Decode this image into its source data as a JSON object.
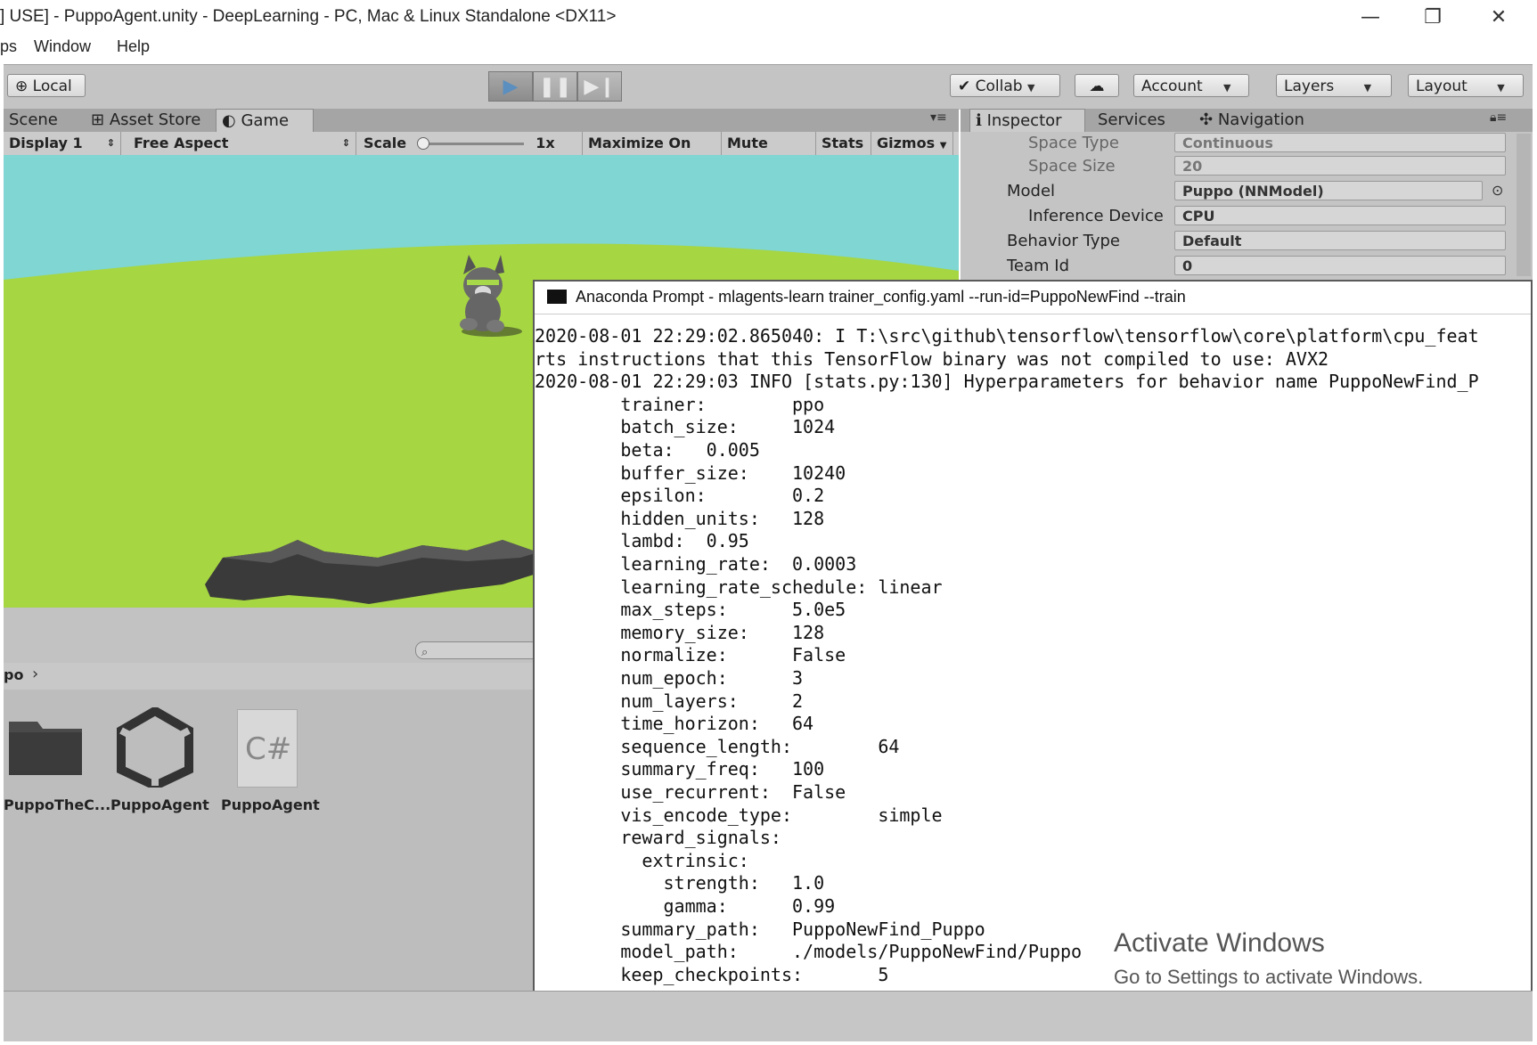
{
  "window": {
    "title": "] USE] - PuppoAgent.unity - DeepLearning - PC, Mac & Linux Standalone <DX11>",
    "controls": {
      "minimize": "—",
      "restore": "❐",
      "close": "✕"
    }
  },
  "menu": {
    "items": [
      "ps",
      "Window",
      "Help"
    ]
  },
  "toolbar": {
    "local": "Local",
    "collab": "Collab",
    "account": "Account",
    "layers": "Layers",
    "layout": "Layout"
  },
  "tabs": {
    "scene": "Scene",
    "asset_store": "Asset Store",
    "game": "Game"
  },
  "gamebar": {
    "display": "Display 1",
    "aspect": "Free Aspect",
    "scale_label": "Scale",
    "scale_value": "1x",
    "maximize": "Maximize On Play",
    "mute": "Mute Audio",
    "stats": "Stats",
    "gizmos": "Gizmos"
  },
  "inspector": {
    "tabs": {
      "inspector": "Inspector",
      "services": "Services",
      "navigation": "Navigation"
    },
    "rows": [
      {
        "label": "Space Type",
        "value": "Continuous"
      },
      {
        "label": "Space Size",
        "value": "20"
      },
      {
        "label": "Model",
        "value": "Puppo (NNModel)"
      },
      {
        "label": "Inference Device",
        "value": "CPU"
      },
      {
        "label": "Behavior Type",
        "value": "Default"
      },
      {
        "label": "Team Id",
        "value": "0"
      }
    ]
  },
  "project": {
    "breadcrumb": "po",
    "assets": [
      "PuppoTheC...",
      "PuppoAgent",
      "PuppoAgent"
    ],
    "csharp_glyph": "C#"
  },
  "console": {
    "title": "Anaconda Prompt - mlagents-learn  trainer_config.yaml --run-id=PuppoNewFind --train",
    "lines": [
      "2020-08-01 22:29:02.865040: I T:\\src\\github\\tensorflow\\tensorflow\\core\\platform\\cpu_feat",
      "rts instructions that this TensorFlow binary was not compiled to use: AVX2",
      "2020-08-01 22:29:03 INFO [stats.py:130] Hyperparameters for behavior name PuppoNewFind_P",
      "        trainer:        ppo",
      "        batch_size:     1024",
      "        beta:   0.005",
      "        buffer_size:    10240",
      "        epsilon:        0.2",
      "        hidden_units:   128",
      "        lambd:  0.95",
      "        learning_rate:  0.0003",
      "        learning_rate_schedule: linear",
      "        max_steps:      5.0e5",
      "        memory_size:    128",
      "        normalize:      False",
      "        num_epoch:      3",
      "        num_layers:     2",
      "        time_horizon:   64",
      "        sequence_length:        64",
      "        summary_freq:   100",
      "        use_recurrent:  False",
      "        vis_encode_type:        simple",
      "        reward_signals:",
      "          extrinsic:",
      "            strength:   1.0",
      "            gamma:      0.99",
      "        summary_path:   PuppoNewFind_Puppo",
      "        model_path:     ./models/PuppoNewFind/Puppo",
      "        keep_checkpoints:       5"
    ]
  },
  "watermark": {
    "title": "Activate Windows",
    "subtitle": "Go to Settings to activate Windows."
  },
  "colors": {
    "sky": "#7fd6d2",
    "grass": "#a6d642",
    "unity_panel": "#c4c4c4"
  }
}
